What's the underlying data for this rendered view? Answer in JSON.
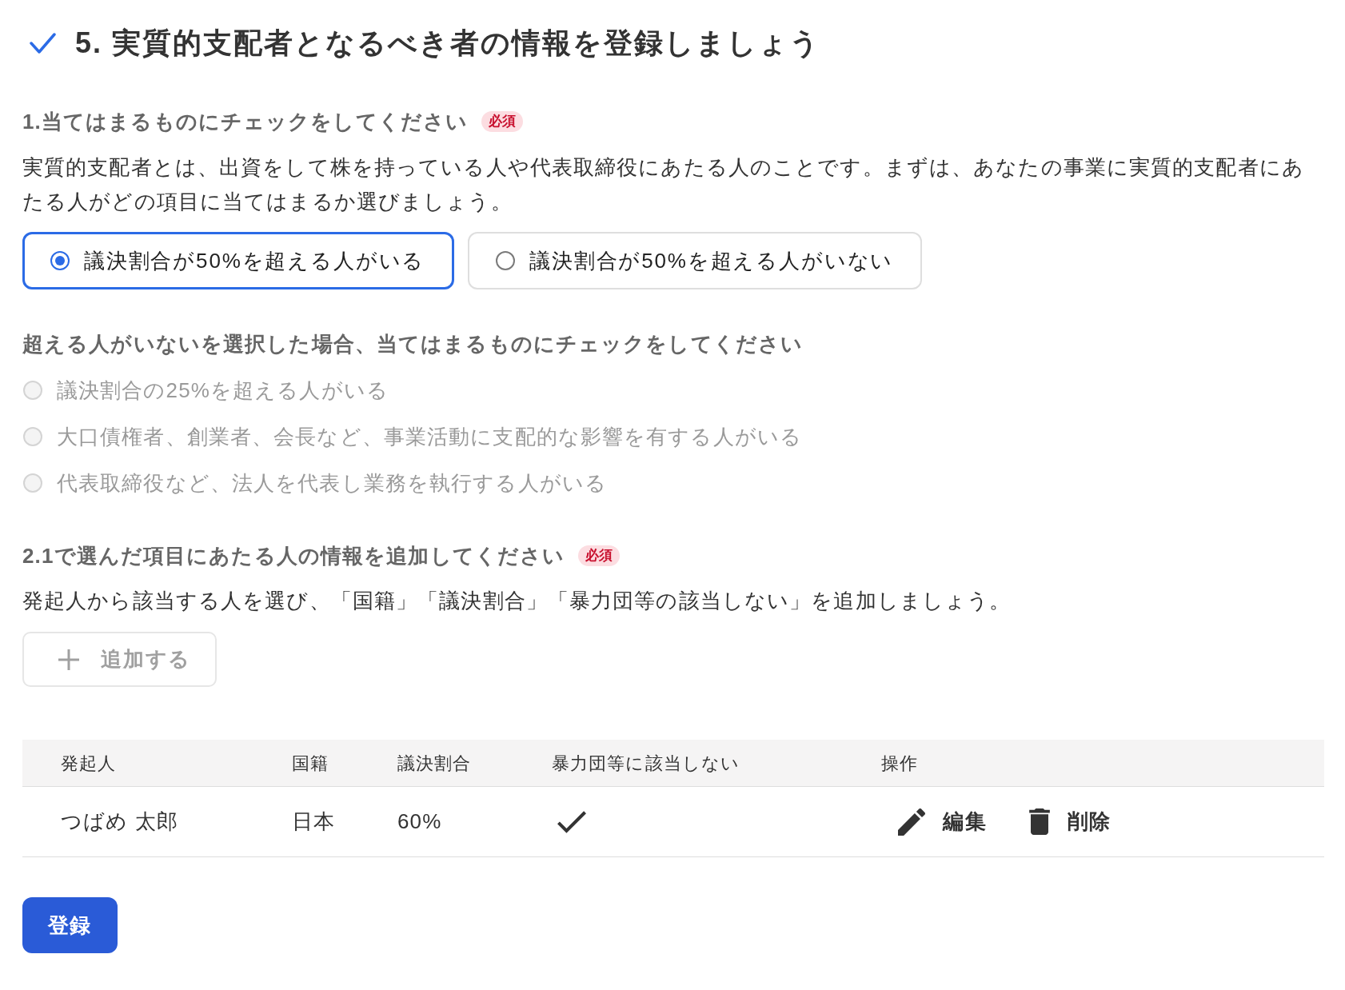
{
  "title": {
    "text": "5. 実質的支配者となるべき者の情報を登録しましょう",
    "completed": true
  },
  "question_1": {
    "label": "1.当てはまるものにチェックをしてください",
    "badge": "必須",
    "description": "実質的支配者とは、出資をして株を持っている人や代表取締役にあたる人のことです。まずは、あなたの事業に実質的支配者にあたる人がどの項目に当てはまるか選びましょう。",
    "options": [
      {
        "label": "議決割合が50%を超える人がいる",
        "selected": true
      },
      {
        "label": "議決割合が50%を超える人がいない",
        "selected": false
      }
    ]
  },
  "question_1_followup": {
    "label": "超える人がいないを選択した場合、当てはまるものにチェックをしてください",
    "options": [
      {
        "label": "議決割合の25%を超える人がいる",
        "selected": false,
        "disabled": true
      },
      {
        "label": "大口債権者、創業者、会長など、事業活動に支配的な影響を有する人がいる",
        "selected": false,
        "disabled": true
      },
      {
        "label": "代表取締役など、法人を代表し業務を執行する人がいる",
        "selected": false,
        "disabled": true
      }
    ]
  },
  "question_2": {
    "label": "2.1で選んだ項目にあたる人の情報を追加してください",
    "badge": "必須",
    "description": "発起人から該当する人を選び、「国籍」「議決割合」「暴力団等の該当しない」を追加しましょう。",
    "add_button": {
      "label": "追加する",
      "disabled": true
    }
  },
  "table": {
    "columns": [
      "発起人",
      "国籍",
      "議決割合",
      "暴力団等に該当しない",
      "操作"
    ],
    "rows": [
      {
        "cells": [
          "つばめ 太郎",
          "日本",
          "60%"
        ],
        "checked": true,
        "actions": [
          {
            "kind": "edit",
            "label": "編集"
          },
          {
            "kind": "delete",
            "label": "削除"
          }
        ]
      }
    ]
  },
  "submit_button": {
    "label": "登録"
  }
}
